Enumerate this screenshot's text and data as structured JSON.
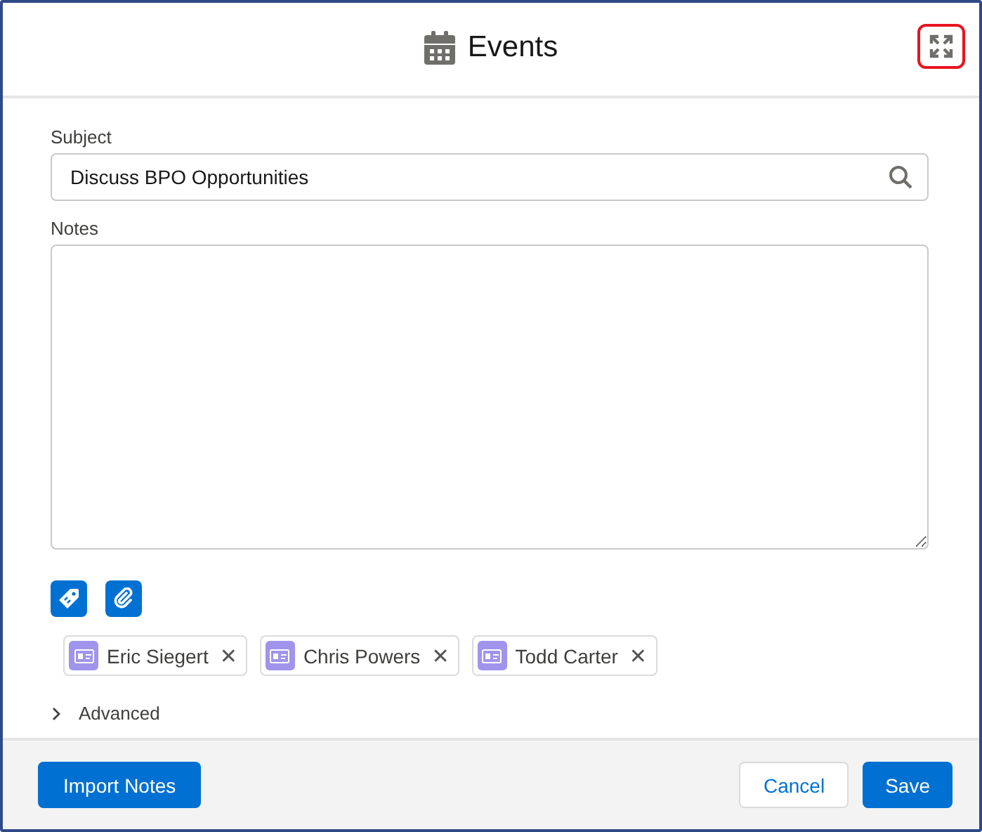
{
  "window": {
    "title": "Events",
    "expand_highlighted": true
  },
  "form": {
    "subject": {
      "label": "Subject",
      "value": "Discuss BPO Opportunities"
    },
    "notes": {
      "label": "Notes"
    }
  },
  "actions": [
    {
      "kind": "tag"
    },
    {
      "kind": "attach"
    }
  ],
  "attendees": [
    {
      "name": "Eric Siegert",
      "remove": "✕"
    },
    {
      "name": "Chris Powers",
      "remove": "✕"
    },
    {
      "name": "Todd Carter",
      "remove": "✕"
    }
  ],
  "advanced": {
    "label": "Advanced",
    "expanded": false
  },
  "footer": {
    "left": "Import Notes",
    "cancel": "Cancel",
    "save": "Save"
  }
}
